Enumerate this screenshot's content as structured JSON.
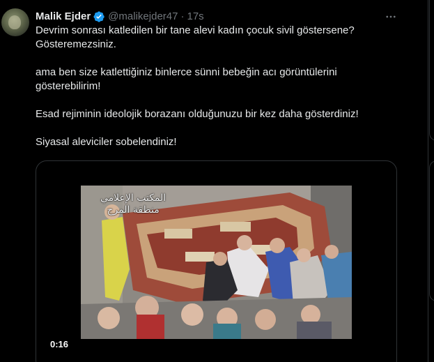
{
  "tweet": {
    "author": {
      "display_name": "Malik Ejder",
      "handle": "@malikejder47",
      "verified": true
    },
    "separator": "·",
    "timestamp": "17s",
    "more_icon": "more-horizontal-icon",
    "text": {
      "line1": "Devrim sonrası katledilen bir tane alevi kadın çocuk sivil göstersene?",
      "line2": "Gösteremezsiniz.",
      "line3": "ama ben size katlettiğiniz binlerce sünni bebeğin acı görüntülerini",
      "line4": "gösterebilirim!",
      "line5": "Esad rejiminin ideolojik borazanı olduğunuzu bir kez daha gösterdiniz!",
      "line6": "Siyasal aleviciler sobelendiniz!"
    },
    "media": {
      "type": "video",
      "duration": "0:16",
      "overlay_line1": "المكتب الإعلامي",
      "overlay_line2": "منطقة المرج"
    }
  },
  "colors": {
    "background": "#000000",
    "text_primary": "#e7e9ea",
    "text_secondary": "#71767b",
    "border": "#2f3336",
    "verified_blue": "#1d9bf0"
  }
}
